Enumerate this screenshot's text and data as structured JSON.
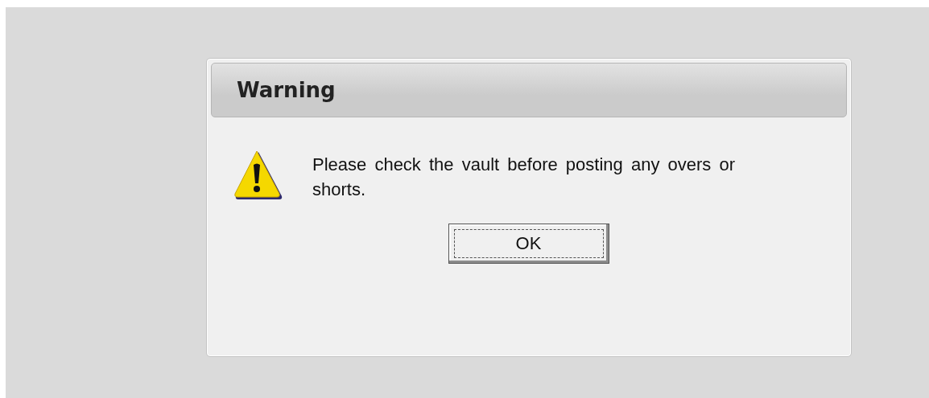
{
  "dialog": {
    "title": "Warning",
    "message": "Please check the vault before posting any overs or shorts.",
    "buttons": [
      {
        "label": "OK",
        "focused": true
      }
    ]
  }
}
